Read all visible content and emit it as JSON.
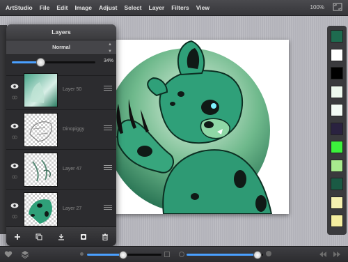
{
  "menubar": {
    "items": [
      "ArtStudio",
      "File",
      "Edit",
      "Image",
      "Adjust",
      "Select",
      "Layer",
      "Filters",
      "View"
    ],
    "zoom": "100%",
    "fullscreen_icon": "fullscreen-icon"
  },
  "layers_panel": {
    "title": "Layers",
    "blend_mode": "Normal",
    "opacity_percent": 34,
    "opacity_label": "34%",
    "layers": [
      {
        "name": "Layer 50",
        "visible": true
      },
      {
        "name": "Dinopiggy",
        "visible": true
      },
      {
        "name": "Layer 47",
        "visible": true
      },
      {
        "name": "Layer 27",
        "visible": true
      }
    ],
    "footer_icons": [
      "add-layer-icon",
      "duplicate-layer-icon",
      "merge-down-icon",
      "layer-mask-icon",
      "delete-layer-icon"
    ]
  },
  "swatches": {
    "colors": [
      "#1e6b4f",
      "#ffffff",
      "#000000",
      "#eef9ee",
      "#f3fbf5",
      "#2a2240",
      "#3cf23c",
      "#a8ea8e",
      "#1a5a44",
      "#f4f0b0",
      "#f4eea0"
    ]
  },
  "bottombar": {
    "brush_size_fraction": 0.48,
    "brush_opacity_fraction": 0.92,
    "icons": [
      "heart-icon",
      "layers-icon",
      "undo-icon",
      "redo-icon"
    ]
  },
  "colors": {
    "accent": "#4aa0ff",
    "character_green": "#2fa079",
    "dark_green": "#1b5e45"
  }
}
